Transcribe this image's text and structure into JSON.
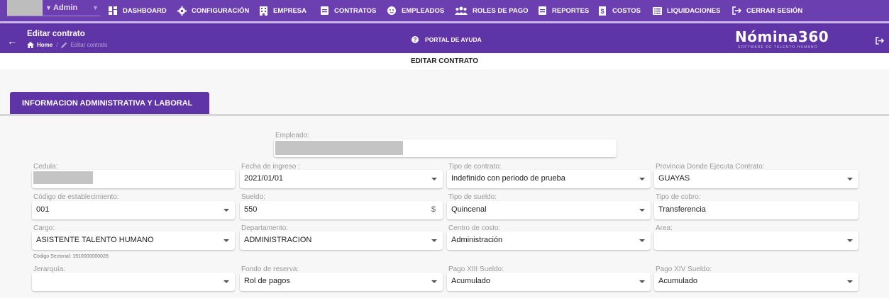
{
  "topnav": {
    "user_name": "Admin",
    "items": [
      {
        "label": "DASHBOARD",
        "icon": "dashboard-icon"
      },
      {
        "label": "CONFIGURACIÓN",
        "icon": "gear-icon"
      },
      {
        "label": "EMPRESA",
        "icon": "building-icon"
      },
      {
        "label": "CONTRATOS",
        "icon": "contract-icon"
      },
      {
        "label": "EMPLEADOS",
        "icon": "face-icon"
      },
      {
        "label": "ROLES DE PAGO",
        "icon": "users-icon"
      },
      {
        "label": "REPORTES",
        "icon": "report-icon"
      },
      {
        "label": "COSTOS",
        "icon": "costs-icon"
      },
      {
        "label": "LIQUIDACIONES",
        "icon": "list-icon"
      },
      {
        "label": "CERRAR SESIÓN",
        "icon": "logout-icon"
      }
    ]
  },
  "header": {
    "title": "Editar contrato",
    "breadcrumb_home": "Home",
    "breadcrumb_current": "Editar contrato",
    "help_label": "PORTAL DE AYUDA",
    "logo_text": "Nómina360",
    "logo_sub": "SOFTWARE DE TALENTO HUMANO"
  },
  "section_title": "EDITAR CONTRATO",
  "tab_label": "INFORMACION ADMINISTRATIVA Y LABORAL",
  "form": {
    "empleado": {
      "label": "Empleado:",
      "value": ""
    },
    "cedula": {
      "label": "Cedula:",
      "value": ""
    },
    "fecha_ingreso": {
      "label": "Fecha de ingreso :",
      "value": "2021/01/01"
    },
    "tipo_contrato": {
      "label": "Tipo de contrato:",
      "value": "Indefinido con periodo de prueba"
    },
    "provincia": {
      "label": "Provincia Donde Ejecuta Contrato:",
      "value": "GUAYAS"
    },
    "codigo_establecimiento": {
      "label": "Código de establecimiento:",
      "value": "001"
    },
    "sueldo": {
      "label": "Sueldo:",
      "value": "550",
      "suffix": "$"
    },
    "tipo_sueldo": {
      "label": "Tipo de sueldo:",
      "value": "Quincenal"
    },
    "tipo_cobro": {
      "label": "Tipo de cobro:",
      "value": "Transferencia"
    },
    "cargo": {
      "label": "Cargo:",
      "value": "ASISTENTE TALENTO HUMANO",
      "hint": "Código Sectorial: 1910000000028"
    },
    "departamento": {
      "label": "Departamento:",
      "value": "ADMINISTRACION"
    },
    "centro_costo": {
      "label": "Centro de costo:",
      "value": "Administración"
    },
    "area": {
      "label": "Area:",
      "value": ""
    },
    "jerarquia": {
      "label": "Jerarquía:",
      "value": ""
    },
    "fondo_reserva": {
      "label": "Fondo de reserva:",
      "value": "Rol de pagos"
    },
    "pago_xiii": {
      "label": "Pago XIII Sueldo:",
      "value": "Acumulado"
    },
    "pago_xiv": {
      "label": "Pago XIV Sueldo:",
      "value": "Acumulado"
    }
  }
}
